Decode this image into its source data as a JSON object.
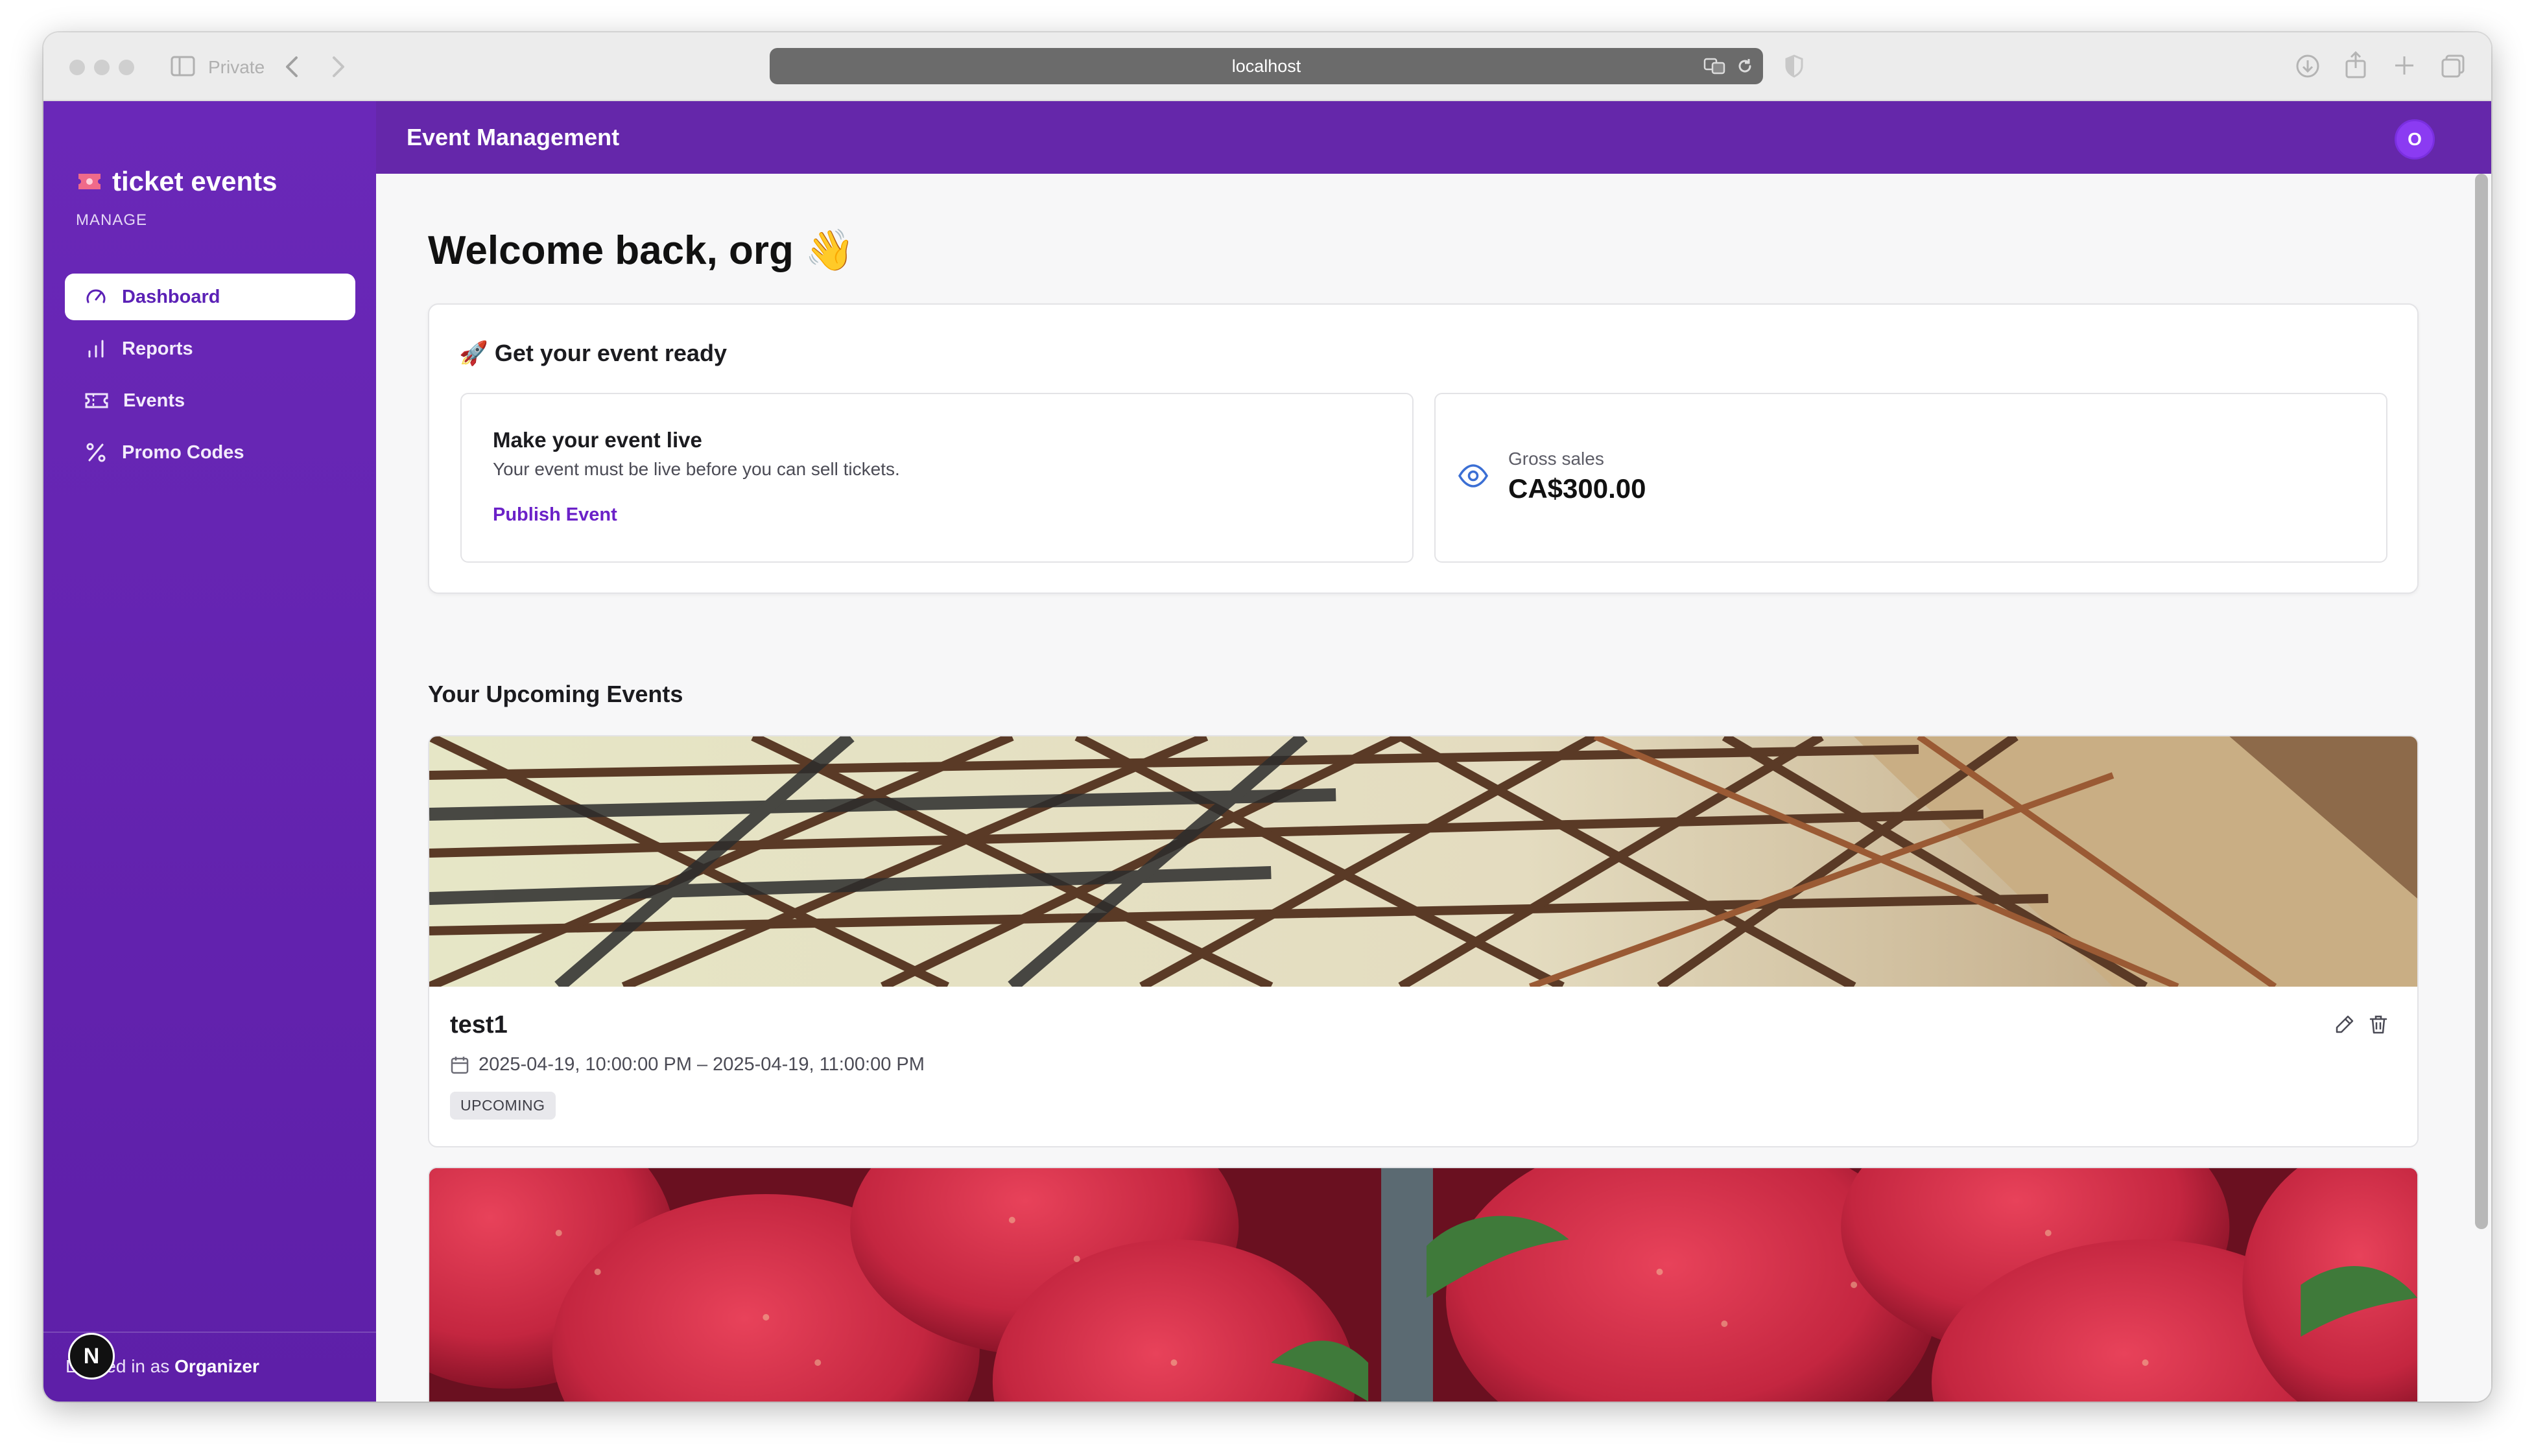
{
  "browser": {
    "private_label": "Private",
    "url": "localhost"
  },
  "sidebar": {
    "brand": "ticket events",
    "section_label": "MANAGE",
    "items": [
      {
        "label": "Dashboard",
        "icon": "gauge-icon",
        "active": true
      },
      {
        "label": "Reports",
        "icon": "bar-chart-icon",
        "active": false
      },
      {
        "label": "Events",
        "icon": "ticket-icon",
        "active": false
      },
      {
        "label": "Promo Codes",
        "icon": "percent-icon",
        "active": false
      }
    ],
    "footer": {
      "prefix": "Logged in as",
      "role": "Organizer"
    },
    "dev_badge": "N"
  },
  "topbar": {
    "title": "Event Management",
    "avatar_initial": "O"
  },
  "main": {
    "welcome": "Welcome back, org 👋",
    "ready_card": {
      "title": "🚀 Get your event ready",
      "live": {
        "title": "Make your event live",
        "description": "Your event must be live before you can sell tickets.",
        "link": "Publish Event"
      },
      "gross": {
        "label": "Gross sales",
        "value": "CA$300.00"
      }
    },
    "upcoming_title": "Your Upcoming Events",
    "events": [
      {
        "name": "test1",
        "dates": "2025-04-19, 10:00:00 PM – 2025-04-19, 11:00:00 PM",
        "status": "UPCOMING",
        "image": "steel-truss-photo"
      },
      {
        "image": "strawberries-photo"
      }
    ]
  },
  "colors": {
    "sidebar": "#6a28b8",
    "topbar": "#6527aa",
    "accent": "#6b21c8",
    "avatar": "#8b3bf2"
  }
}
